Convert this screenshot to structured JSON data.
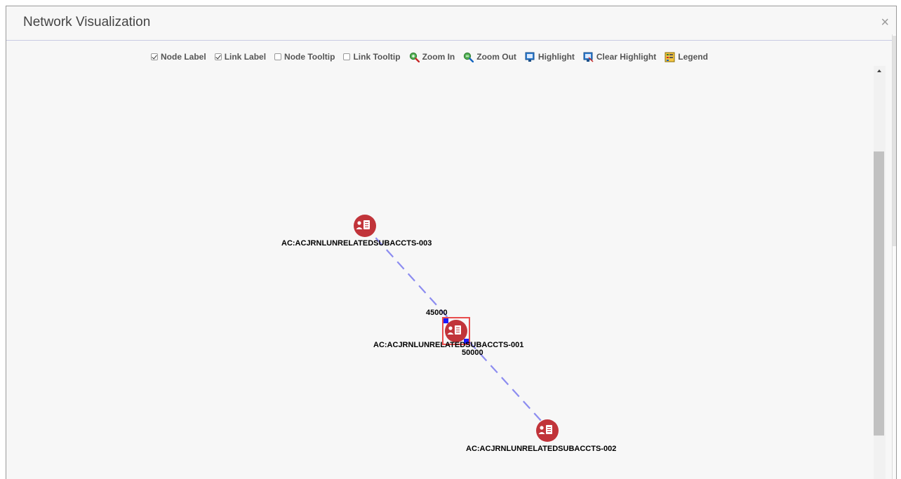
{
  "window": {
    "title": "Network Visualization",
    "close_glyph": "×"
  },
  "toolbar": {
    "items": [
      {
        "label": "Node Label",
        "kind": "checkbox",
        "checked": true
      },
      {
        "label": "Link Label",
        "kind": "checkbox",
        "checked": true
      },
      {
        "label": "Node Tooltip",
        "kind": "checkbox",
        "checked": false
      },
      {
        "label": "Link Tooltip",
        "kind": "checkbox",
        "checked": false
      },
      {
        "label": "Zoom In",
        "kind": "button",
        "icon": "zoom-in-icon"
      },
      {
        "label": "Zoom Out",
        "kind": "button",
        "icon": "zoom-out-icon"
      },
      {
        "label": "Highlight",
        "kind": "button",
        "icon": "highlight-icon"
      },
      {
        "label": "Clear Highlight",
        "kind": "button",
        "icon": "clear-highlight-icon"
      },
      {
        "label": "Legend",
        "kind": "button",
        "icon": "legend-icon"
      }
    ]
  },
  "graph": {
    "nodes": [
      {
        "id": "n3",
        "label": "AC:ACJRNLUNRELATEDSUBACCTS-003",
        "icon": "account-icon",
        "selected": false
      },
      {
        "id": "n1",
        "label": "AC:ACJRNLUNRELATEDSUBACCTS-001",
        "icon": "account-icon",
        "selected": true
      },
      {
        "id": "n2",
        "label": "AC:ACJRNLUNRELATEDSUBACCTS-002",
        "icon": "account-icon",
        "selected": false
      }
    ],
    "links": [
      {
        "from": "n3",
        "to": "n1",
        "label": "45000"
      },
      {
        "from": "n1",
        "to": "n2",
        "label": "50000"
      }
    ]
  },
  "colors": {
    "node_fill": "#c1343a",
    "link_stroke": "#8c8cf0",
    "selection": "#e84c4c",
    "arrow": "#1a1aff"
  }
}
